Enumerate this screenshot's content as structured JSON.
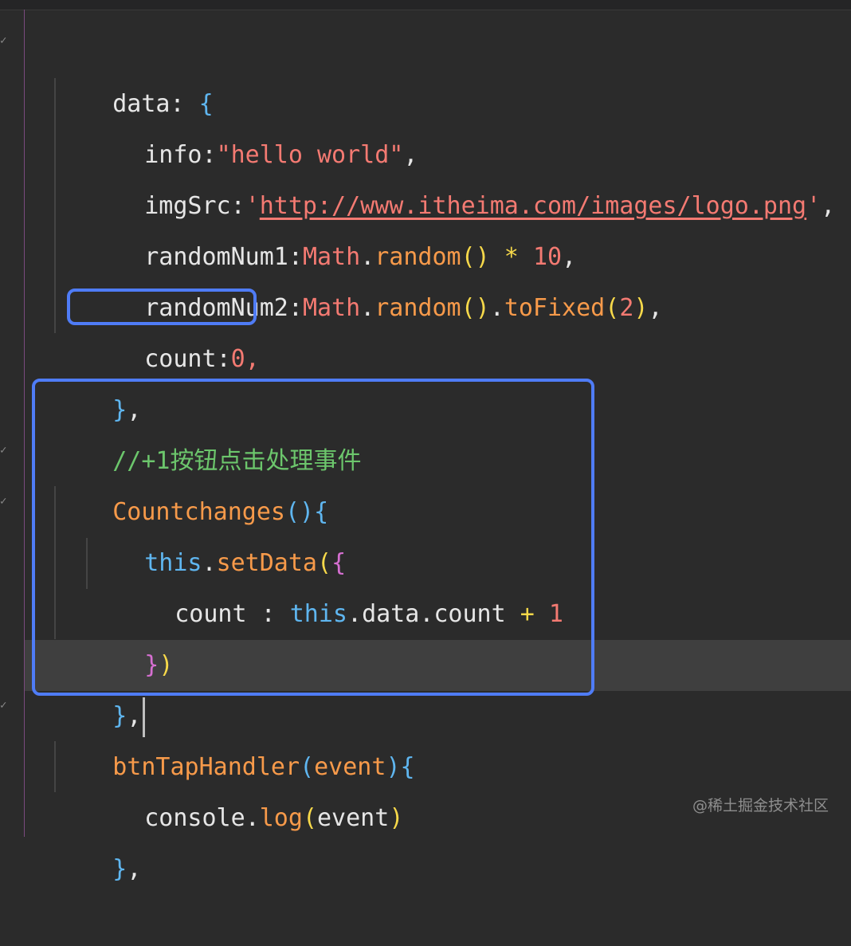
{
  "lines": [
    {
      "key": "data",
      "colon": ": ",
      "open": "{"
    },
    {
      "key": "info",
      "colon": ":",
      "value": "\"hello world\"",
      "comma": ","
    },
    {
      "key": "imgSrc",
      "colon": ":",
      "q1": "'",
      "url": "http://www.itheima.com/images/logo.png",
      "q2": "'",
      "comma": ","
    },
    {
      "key": "randomNum1",
      "colon": ":",
      "cls": "Math",
      "dot": ".",
      "fn": "random",
      "paren": "()",
      "op": " * ",
      "num": "10",
      "comma": ","
    },
    {
      "key": "randomNum2",
      "colon": ":",
      "cls": "Math",
      "dot1": ".",
      "fn1": "random",
      "paren1": "()",
      "dot2": ".",
      "fn2": "toFixed",
      "popen": "(",
      "num": "2",
      "pclose": ")",
      "comma": ","
    },
    {
      "key": "count",
      "colon": ":",
      "num": "0",
      "comma": ","
    },
    {
      "close": "}",
      "comma": ","
    },
    {
      "comment": "//+1按钮点击处理事件"
    },
    {
      "fn": "Countchanges",
      "paren": "()",
      "open": "{"
    },
    {
      "this": "this",
      "dot": ".",
      "fn": "setData",
      "popen": "(",
      "bopen": "{"
    },
    {
      "key": "count",
      "colon": " : ",
      "this": "this",
      "dot1": ".",
      "prop1": "data",
      "dot2": ".",
      "prop2": "count",
      "op": " + ",
      "num": "1"
    },
    {
      "bclose": "}",
      "pclose": ")"
    },
    {
      "close": "}",
      "comma": ","
    },
    {
      "fn": "btnTapHandler",
      "popen": "(",
      "arg": "event",
      "pclose": ")",
      "open": "{"
    },
    {
      "obj": "console",
      "dot": ".",
      "fn": "log",
      "popen": "(",
      "arg": "event",
      "pclose": ")"
    },
    {
      "close": "}",
      "comma": ","
    }
  ],
  "colors": {
    "background": "#2b2b2b",
    "highlight_box": "#4f7cf6",
    "string": "#f47a72",
    "function": "#f79a4a",
    "brace": "#5fb6f0",
    "comment": "#6cc66c"
  },
  "watermark": "@稀土掘金技术社区"
}
